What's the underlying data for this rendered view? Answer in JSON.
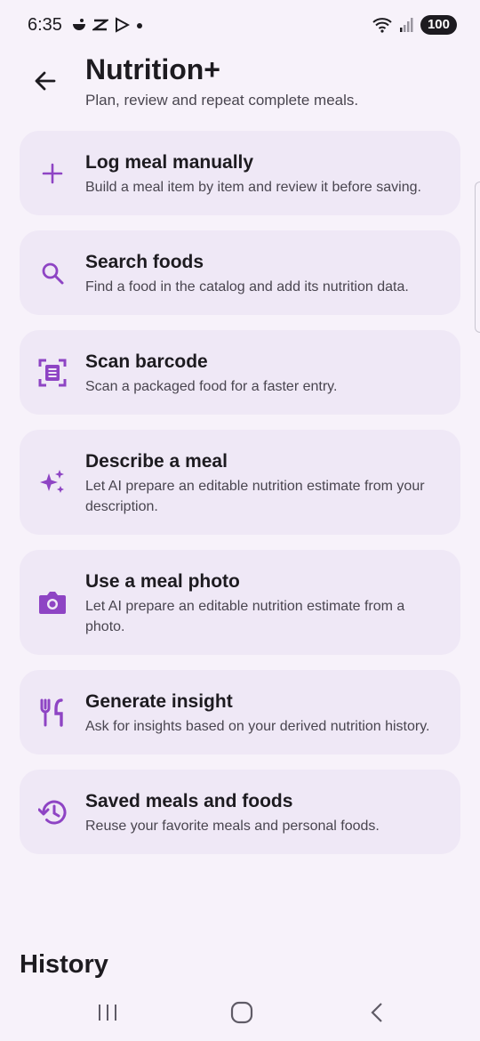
{
  "status": {
    "time": "6:35",
    "battery": "100"
  },
  "header": {
    "title": "Nutrition+",
    "subtitle": "Plan, review and repeat complete meals."
  },
  "actions": [
    {
      "title": "Log meal manually",
      "description": "Build a meal item by item and review it before saving.",
      "icon": "plus-icon"
    },
    {
      "title": "Search foods",
      "description": "Find a food in the catalog and add its nutrition data.",
      "icon": "search-icon"
    },
    {
      "title": "Scan barcode",
      "description": "Scan a packaged food for a faster entry.",
      "icon": "barcode-scan-icon"
    },
    {
      "title": "Describe a meal",
      "description": "Let AI prepare an editable nutrition estimate from your description.",
      "icon": "sparkle-icon"
    },
    {
      "title": "Use a meal photo",
      "description": "Let AI prepare an editable nutrition estimate from a photo.",
      "icon": "camera-icon"
    },
    {
      "title": "Generate insight",
      "description": "Ask for insights based on your derived nutrition history.",
      "icon": "restaurant-icon"
    },
    {
      "title": "Saved meals and foods",
      "description": "Reuse your favorite meals and personal foods.",
      "icon": "history-icon"
    }
  ],
  "history": {
    "heading": "History"
  },
  "colors": {
    "accent": "#8e44c4",
    "card_background": "#efe8f6",
    "page_background": "#f7f2fa"
  }
}
